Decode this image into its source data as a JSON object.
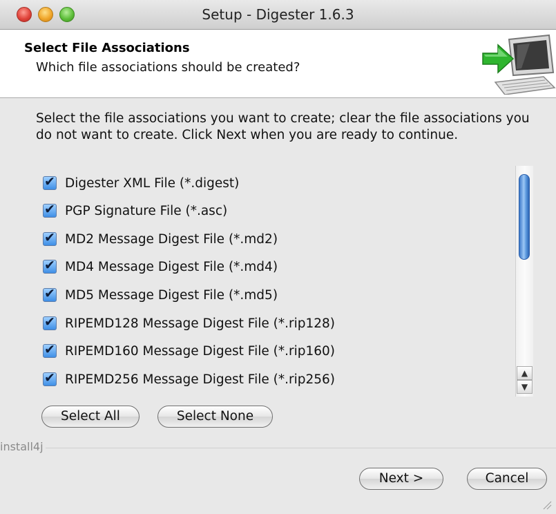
{
  "window": {
    "title": "Setup - Digester 1.6.3"
  },
  "header": {
    "title": "Select File Associations",
    "subtitle": "Which file associations should be created?",
    "icon": "computer-install-arrow-icon"
  },
  "description": "Select the file associations you want to create; clear the file associations you do not want to create. Click Next when you are ready to continue.",
  "associations": [
    {
      "label": "Digester XML File (*.digest)",
      "checked": true
    },
    {
      "label": "PGP Signature File (*.asc)",
      "checked": true
    },
    {
      "label": "MD2 Message Digest File (*.md2)",
      "checked": true
    },
    {
      "label": "MD4 Message Digest File (*.md4)",
      "checked": true
    },
    {
      "label": "MD5 Message Digest File (*.md5)",
      "checked": true
    },
    {
      "label": "RIPEMD128 Message Digest File (*.rip128)",
      "checked": true
    },
    {
      "label": "RIPEMD160 Message Digest File (*.rip160)",
      "checked": true
    },
    {
      "label": "RIPEMD256 Message Digest File (*.rip256)",
      "checked": true
    }
  ],
  "buttons": {
    "select_all": "Select All",
    "select_none": "Select None",
    "next": "Next >",
    "cancel": "Cancel"
  },
  "footer": {
    "brand": "install4j"
  },
  "colors": {
    "accent": "#3f8fe6",
    "arrow": "#2fb52f"
  }
}
